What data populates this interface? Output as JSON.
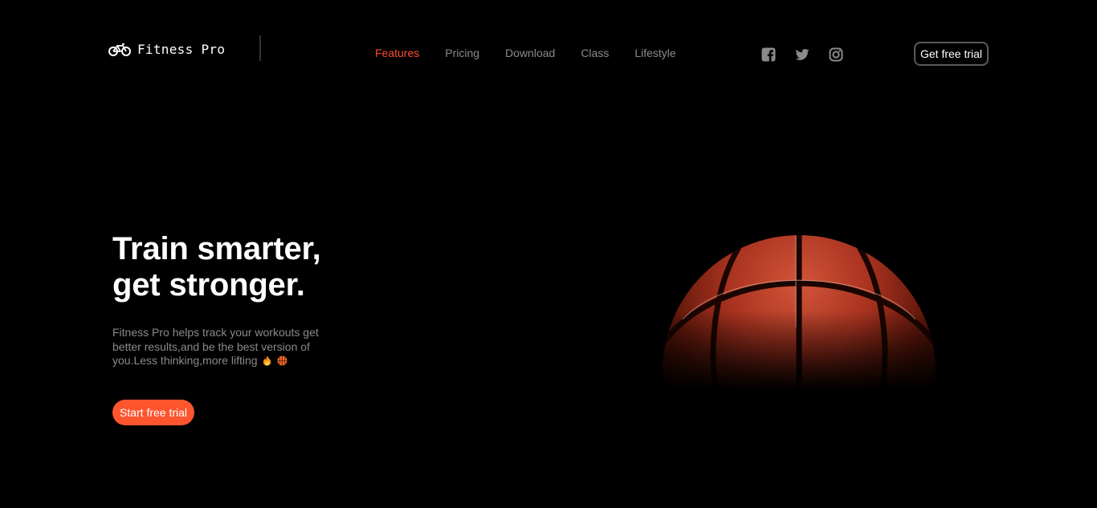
{
  "brand": {
    "name": "Fitness Pro",
    "icon": "bicycle-icon"
  },
  "nav": {
    "links": [
      {
        "label": "Features",
        "active": true
      },
      {
        "label": "Pricing",
        "active": false
      },
      {
        "label": "Download",
        "active": false
      },
      {
        "label": "Class",
        "active": false
      },
      {
        "label": "Lifestyle",
        "active": false
      }
    ]
  },
  "social": [
    {
      "icon": "facebook-icon"
    },
    {
      "icon": "twitter-icon"
    },
    {
      "icon": "instagram-icon"
    }
  ],
  "header": {
    "trial_label": "Get free trial"
  },
  "hero": {
    "title_line1": "Train smarter,",
    "title_line2": "get stronger.",
    "description": "Fitness Pro helps track your workouts get better results,and be the best version of you.Less thinking,more lifting",
    "emojis": [
      "fire-emoji",
      "basketball-emoji"
    ],
    "cta_label": "Start free trial"
  },
  "colors": {
    "accent": "#ff4d2e",
    "cta": "#ff552e",
    "muted": "#8a8a8a",
    "background": "#000000"
  }
}
